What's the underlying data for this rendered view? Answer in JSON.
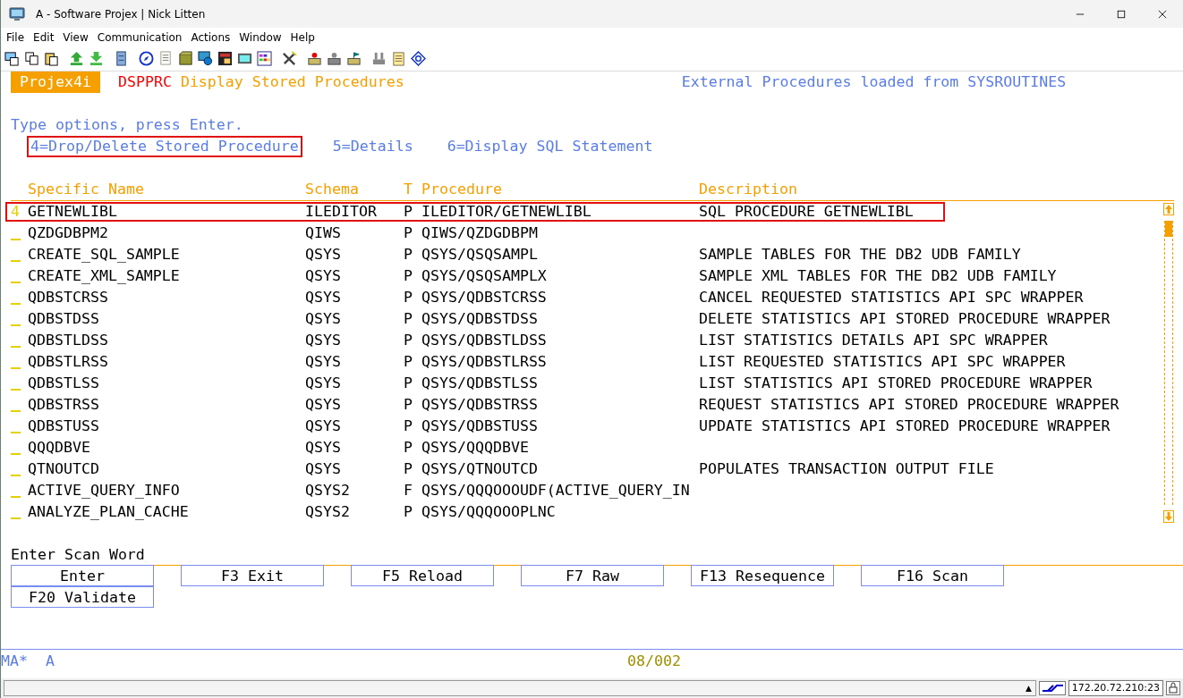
{
  "window": {
    "title": "A - Software Projex | Nick Litten"
  },
  "menu": [
    "File",
    "Edit",
    "View",
    "Communication",
    "Actions",
    "Window",
    "Help"
  ],
  "screen": {
    "badge": "Projex4i",
    "command": "DSPPRC",
    "heading": "Display Stored Procedures",
    "source_note": "External Procedures loaded from SYSROUTINES",
    "instruction": "Type options, press Enter.",
    "options": [
      {
        "label": "4=Drop/Delete Stored Procedure",
        "highlighted": true
      },
      {
        "label": "5=Details",
        "highlighted": false
      },
      {
        "label": "6=Display SQL Statement",
        "highlighted": false
      }
    ],
    "columns": [
      "Specific Name",
      "Schema",
      "T",
      "Procedure",
      "Description"
    ],
    "rows": [
      {
        "option": "4",
        "highlighted": true,
        "cells": [
          "GETNEWLIBL",
          "ILEDITOR",
          "P",
          "ILEDITOR/GETNEWLIBL",
          "SQL PROCEDURE GETNEWLIBL"
        ]
      },
      {
        "option": "",
        "highlighted": false,
        "cells": [
          "QZDGDBPM2",
          "QIWS",
          "P",
          "QIWS/QZDGDBPM",
          ""
        ]
      },
      {
        "option": "",
        "highlighted": false,
        "cells": [
          "CREATE_SQL_SAMPLE",
          "QSYS",
          "P",
          "QSYS/QSQSAMPL",
          "SAMPLE TABLES FOR THE DB2 UDB FAMILY"
        ]
      },
      {
        "option": "",
        "highlighted": false,
        "cells": [
          "CREATE_XML_SAMPLE",
          "QSYS",
          "P",
          "QSYS/QSQSAMPLX",
          "SAMPLE XML TABLES FOR THE DB2 UDB FAMILY"
        ]
      },
      {
        "option": "",
        "highlighted": false,
        "cells": [
          "QDBSTCRSS",
          "QSYS",
          "P",
          "QSYS/QDBSTCRSS",
          "CANCEL REQUESTED STATISTICS API SPC WRAPPER"
        ]
      },
      {
        "option": "",
        "highlighted": false,
        "cells": [
          "QDBSTDSS",
          "QSYS",
          "P",
          "QSYS/QDBSTDSS",
          "DELETE STATISTICS API STORED PROCEDURE WRAPPER"
        ]
      },
      {
        "option": "",
        "highlighted": false,
        "cells": [
          "QDBSTLDSS",
          "QSYS",
          "P",
          "QSYS/QDBSTLDSS",
          "LIST STATISTICS DETAILS API SPC WRAPPER"
        ]
      },
      {
        "option": "",
        "highlighted": false,
        "cells": [
          "QDBSTLRSS",
          "QSYS",
          "P",
          "QSYS/QDBSTLRSS",
          "LIST REQUESTED STATISTICS API SPC WRAPPER"
        ]
      },
      {
        "option": "",
        "highlighted": false,
        "cells": [
          "QDBSTLSS",
          "QSYS",
          "P",
          "QSYS/QDBSTLSS",
          "LIST STATISTICS API STORED PROCEDURE WRAPPER"
        ]
      },
      {
        "option": "",
        "highlighted": false,
        "cells": [
          "QDBSTRSS",
          "QSYS",
          "P",
          "QSYS/QDBSTRSS",
          "REQUEST STATISTICS API STORED PROCEDURE WRAPPER"
        ]
      },
      {
        "option": "",
        "highlighted": false,
        "cells": [
          "QDBSTUSS",
          "QSYS",
          "P",
          "QSYS/QDBSTUSS",
          "UPDATE STATISTICS API STORED PROCEDURE WRAPPER"
        ]
      },
      {
        "option": "",
        "highlighted": false,
        "cells": [
          "QQQDBVE",
          "QSYS",
          "P",
          "QSYS/QQQDBVE",
          ""
        ]
      },
      {
        "option": "",
        "highlighted": false,
        "cells": [
          "QTNOUTCD",
          "QSYS",
          "P",
          "QSYS/QTNOUTCD",
          "POPULATES TRANSACTION OUTPUT FILE"
        ]
      },
      {
        "option": "",
        "highlighted": false,
        "cells": [
          "ACTIVE_QUERY_INFO",
          "QSYS2",
          "F",
          "QSYS/QQQOOOUDF(ACTIVE_QUERY_IN",
          ""
        ]
      },
      {
        "option": "",
        "highlighted": false,
        "cells": [
          "ANALYZE_PLAN_CACHE",
          "QSYS2",
          "P",
          "QSYS/QQQOOOPLNC",
          ""
        ]
      }
    ],
    "scan_label": "Enter Scan Word",
    "function_keys": [
      "Enter",
      "F3 Exit",
      "F5 Reload",
      "F7 Raw",
      "F13 Resequence",
      "F16 Scan",
      "F20 Validate"
    ]
  },
  "operator_line": {
    "mode": "MA*",
    "session": "A",
    "cursor": "08/002"
  },
  "status_bar": {
    "scroll_glyph": "▲",
    "host": "172.20.72.210:23"
  }
}
